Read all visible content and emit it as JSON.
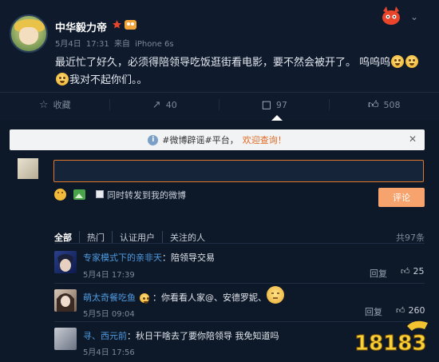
{
  "post": {
    "username": "中华毅力帝",
    "date": "5月4日",
    "time": "17:31",
    "source_prefix": "来自",
    "source": "iPhone 6s",
    "text": "最近忙了好久，必须得陪领导吃饭逛街看电影，要不然会被开了。 呜呜呜",
    "text_line2": "我对不起你们。。"
  },
  "actions": {
    "favorite_label": "收藏",
    "repost_count": "40",
    "comment_count": "97",
    "like_count": "508"
  },
  "notice": {
    "prefix": "#微博辟谣#平台，",
    "highlight": "欢迎查询！"
  },
  "compose": {
    "input_value": "",
    "repost_label": "同时转发到我的微博",
    "submit_label": "评论"
  },
  "filters": {
    "items": [
      "全部",
      "热门",
      "认证用户",
      "关注的人"
    ],
    "total": "共97条"
  },
  "comments": [
    {
      "user": "专家模式下的亲非天",
      "text": "：陪领导交易",
      "time": "5月4日 17:39",
      "reply": "回复",
      "likes": "25"
    },
    {
      "user": "萌太奇餐吃鱼",
      "text": "：你看看人家@、安德罗妮、",
      "time": "5月5日 09:04",
      "reply": "回复",
      "likes": "260"
    },
    {
      "user": "寻、西元前",
      "text": "：秋日干啥去了要你陪领导 我免知道吗",
      "time": "5月4日 17:56",
      "reply": "",
      "likes": ""
    }
  ],
  "watermark": {
    "text": "18183"
  },
  "colors": {
    "background": "#0f1b2d",
    "accent_orange": "#e07a2a",
    "link_blue": "#4f9be0",
    "submit_button": "#f7a36d"
  }
}
